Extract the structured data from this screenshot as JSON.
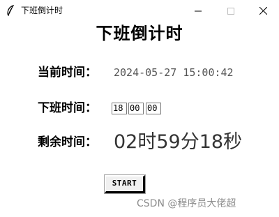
{
  "window": {
    "title": "下班倒计时",
    "icon": "feather-icon",
    "controls": [
      "minimize-icon",
      "maximize-icon",
      "close-icon"
    ]
  },
  "main": {
    "heading": "下班倒计时",
    "current_time": {
      "label": "当前时间：",
      "value": "2024-05-27 15:00:42"
    },
    "off_work_time": {
      "label": "下班时间：",
      "hour": "18",
      "minute": "00",
      "second": "00"
    },
    "remaining_time": {
      "label": "剩余时间：",
      "value": "02时59分18秒"
    },
    "start_button": "START"
  },
  "watermark": "CSDN @程序员大佬超"
}
